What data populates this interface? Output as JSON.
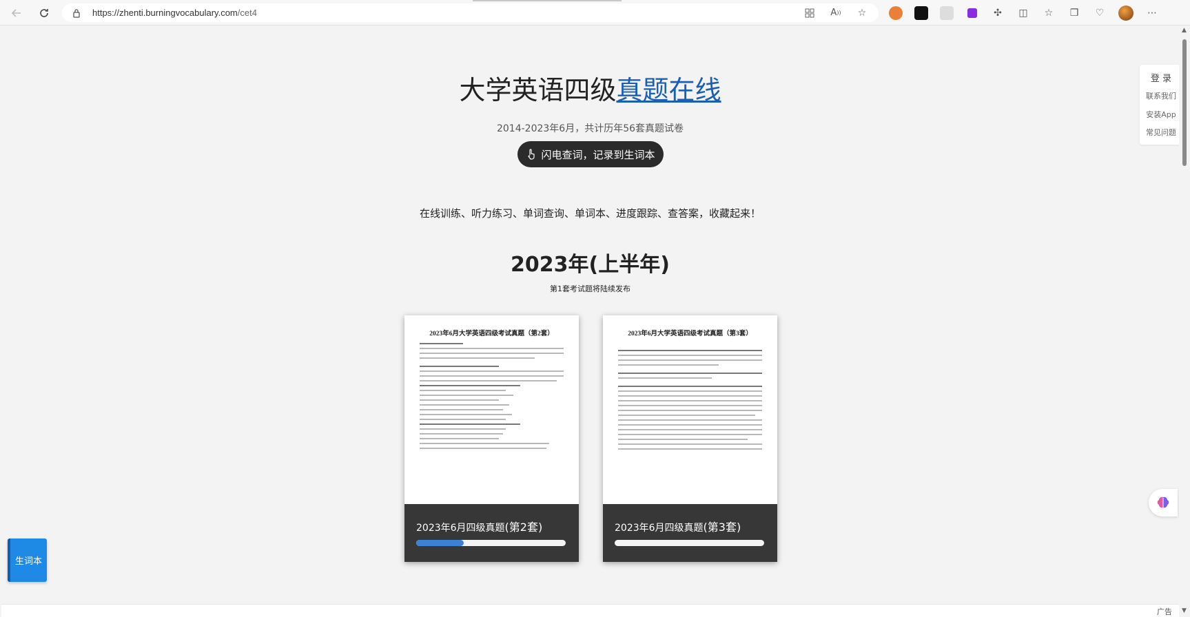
{
  "browser": {
    "url_main": "https://zhenti.burningvocabulary.com",
    "url_path": "/cet4"
  },
  "page": {
    "title_plain": "大学英语四级",
    "title_link": "真题在线",
    "subtitle": "2014-2023年6月，共计历年56套真题试卷",
    "pill_label": "闪电查词，记录到生词本",
    "features": "在线训练、听力练习、单词查询、单词本、进度跟踪、查答案，收藏起来！",
    "year_heading": "2023年(上半年)",
    "year_note": "第1套考试题将陆续发布"
  },
  "cards": [
    {
      "doc_title": "2023年6月大学英语四级考试真题（第2套）",
      "label_main": "2023年6月四级真题",
      "label_set": "(第2套)",
      "progress": 0.32
    },
    {
      "doc_title": "2023年6月大学英语四级考试真题（第3套）",
      "label_main": "2023年6月四级真题",
      "label_set": "(第3套)",
      "progress": 0.0
    }
  ],
  "side_menu": {
    "login": "登 录",
    "contact": "联系我们",
    "install": "安装App",
    "faq": "常见问题"
  },
  "vocab_button": "生词本",
  "ad_label": "广告",
  "colors": {
    "link": "#1a5fb4",
    "pill_bg": "#2b2b2b",
    "progress_fill": "#3b82d6",
    "vocab_button": "#1e8ae6"
  }
}
